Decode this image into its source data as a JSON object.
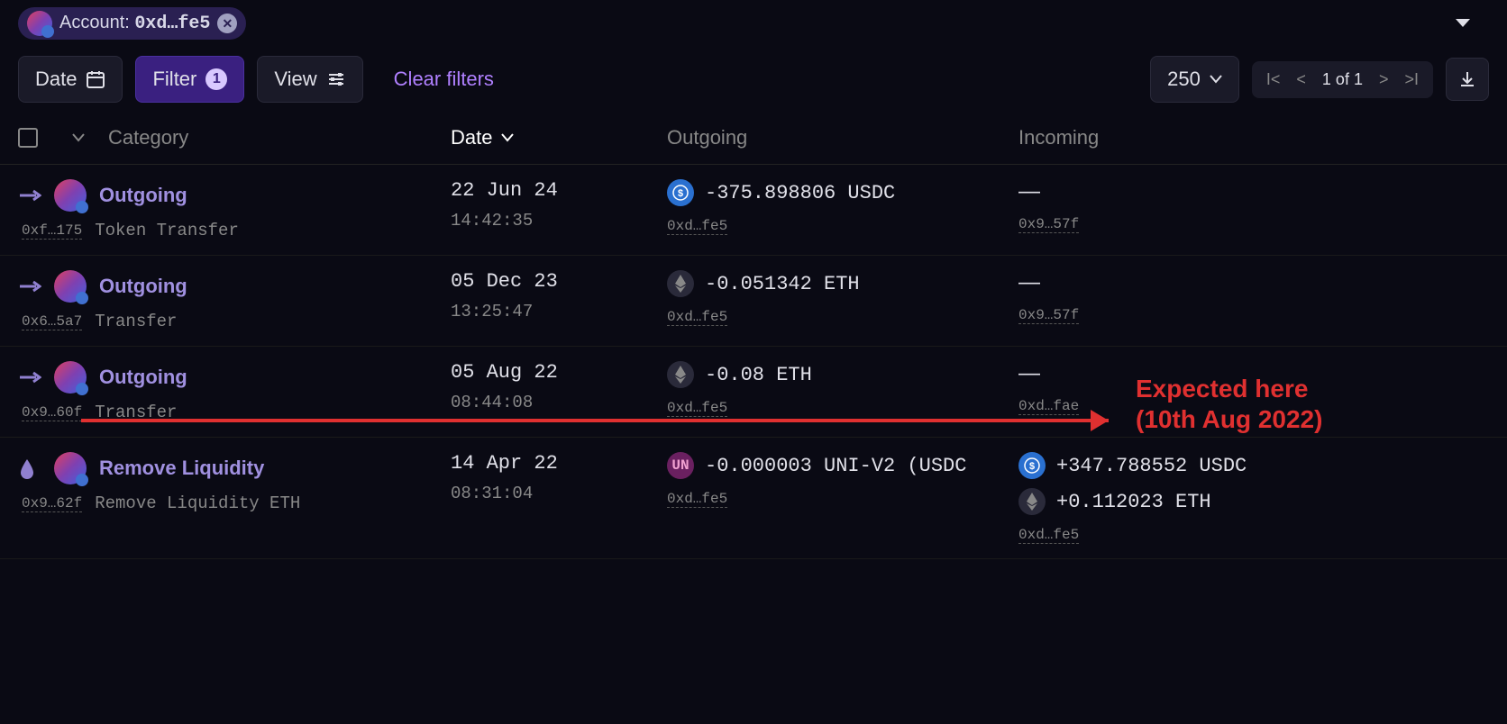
{
  "breadcrumb": {
    "account_prefix": "Account: ",
    "account_short": "0xd…fe5"
  },
  "toolbar": {
    "date": "Date",
    "filter": "Filter",
    "filter_count": "1",
    "view": "View",
    "clear": "Clear filters",
    "page_size": "250",
    "page_pos": "1 of 1"
  },
  "columns": {
    "category": "Category",
    "date": "Date",
    "outgoing": "Outgoing",
    "incoming": "Incoming"
  },
  "rows": [
    {
      "category": "Outgoing",
      "category_icon": "arrow-right",
      "sub_category": "Token Transfer",
      "tx_hash": "0xf…175",
      "date": "22 Jun 24",
      "time": "14:42:35",
      "out_token": "usdc",
      "out_amount": "-375.898806 USDC",
      "out_addr": "0xd…fe5",
      "in_token": null,
      "in_amount": "—",
      "in_addr": "0x9…57f",
      "in_extra": null
    },
    {
      "category": "Outgoing",
      "category_icon": "arrow-right",
      "sub_category": "Transfer",
      "tx_hash": "0x6…5a7",
      "date": "05 Dec 23",
      "time": "13:25:47",
      "out_token": "eth",
      "out_amount": "-0.051342 ETH",
      "out_addr": "0xd…fe5",
      "in_token": null,
      "in_amount": "—",
      "in_addr": "0x9…57f",
      "in_extra": null
    },
    {
      "category": "Outgoing",
      "category_icon": "arrow-right",
      "sub_category": "Transfer",
      "tx_hash": "0x9…60f",
      "date": "05 Aug 22",
      "time": "08:44:08",
      "out_token": "eth",
      "out_amount": "-0.08 ETH",
      "out_addr": "0xd…fe5",
      "in_token": null,
      "in_amount": "—",
      "in_addr": "0xd…fae",
      "in_extra": null
    },
    {
      "category": "Remove Liquidity",
      "category_icon": "drop",
      "sub_category": "Remove Liquidity ETH",
      "tx_hash": "0x9…62f",
      "date": "14 Apr 22",
      "time": "08:31:04",
      "out_token": "uni",
      "out_amount": "-0.000003 UNI-V2 (USDC",
      "out_addr": "0xd…fe5",
      "in_token": "usdc",
      "in_amount": "+347.788552 USDC",
      "in_addr": "0xd…fe5",
      "in_extra": {
        "token": "eth",
        "amount": "+0.112023 ETH"
      }
    }
  ],
  "annotation": {
    "line1": "Expected here",
    "line2": "(10th Aug 2022)"
  }
}
